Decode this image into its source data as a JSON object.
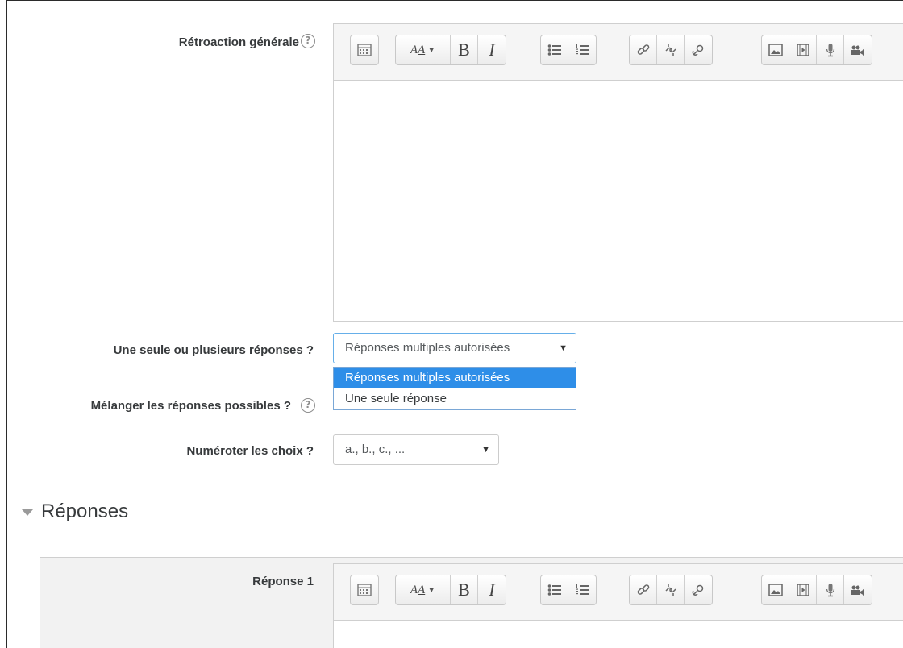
{
  "general_feedback": {
    "label": "Rétroaction générale",
    "help_icon": "question-circle-icon"
  },
  "single_or_multiple": {
    "label": "Une seule ou plusieurs réponses ?",
    "selected": "Réponses multiples autorisées",
    "options": [
      "Réponses multiples autorisées",
      "Une seule réponse"
    ]
  },
  "shuffle": {
    "label": "Mélanger les réponses possibles ?",
    "help_icon": "question-circle-icon"
  },
  "numbering": {
    "label": "Numéroter les choix ?",
    "selected": "a., b., c., ..."
  },
  "answers_section": {
    "title": "Réponses",
    "answer1_label": "Réponse 1"
  },
  "toolbar": {
    "icons": [
      "toolbar-toggle-icon",
      "font-style-icon",
      "bold-icon",
      "italic-icon",
      "unordered-list-icon",
      "ordered-list-icon",
      "link-icon",
      "unlink-icon",
      "emoticon-icon",
      "image-icon",
      "media-icon",
      "record-audio-icon",
      "record-video-icon"
    ],
    "bold_glyph": "B",
    "italic_glyph": "I"
  },
  "colors": {
    "selection": "#2e8ee8",
    "focus_border": "#66afe9"
  }
}
